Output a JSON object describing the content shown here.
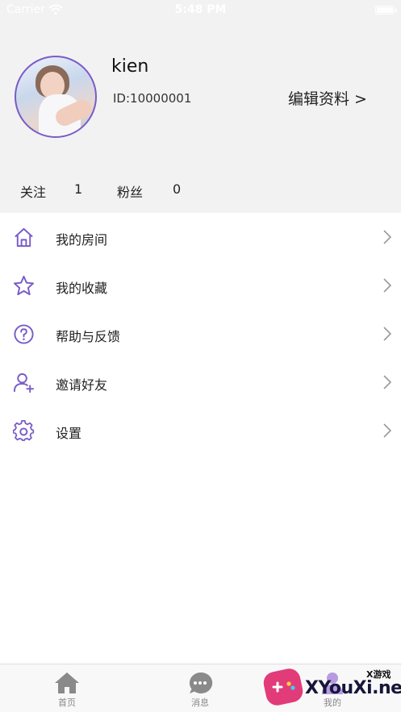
{
  "status_bar": {
    "carrier": "Carrier",
    "time": "5:48 PM"
  },
  "profile": {
    "name": "kien",
    "id_text": "ID:10000001",
    "edit_label": "编辑资料 >"
  },
  "stats": [
    {
      "label": "关注",
      "value": "1"
    },
    {
      "label": "粉丝",
      "value": "0"
    }
  ],
  "menu": [
    {
      "label": "我的房间",
      "icon": "home-icon"
    },
    {
      "label": "我的收藏",
      "icon": "star-icon"
    },
    {
      "label": "帮助与反馈",
      "icon": "help-icon"
    },
    {
      "label": "邀请好友",
      "icon": "add-user-icon"
    },
    {
      "label": "设置",
      "icon": "gear-icon"
    }
  ],
  "tabbar": [
    {
      "label": "首页",
      "icon": "home-tab-icon"
    },
    {
      "label": "消息",
      "icon": "message-icon"
    },
    {
      "label": "我的",
      "icon": "me-icon"
    }
  ],
  "watermark": {
    "small": "X游戏",
    "main": "XYouXi.net"
  },
  "colors": {
    "accent": "#7a5bc7",
    "header_bg": "#f2f2f2",
    "tab_icon": "#8a8a8a"
  }
}
